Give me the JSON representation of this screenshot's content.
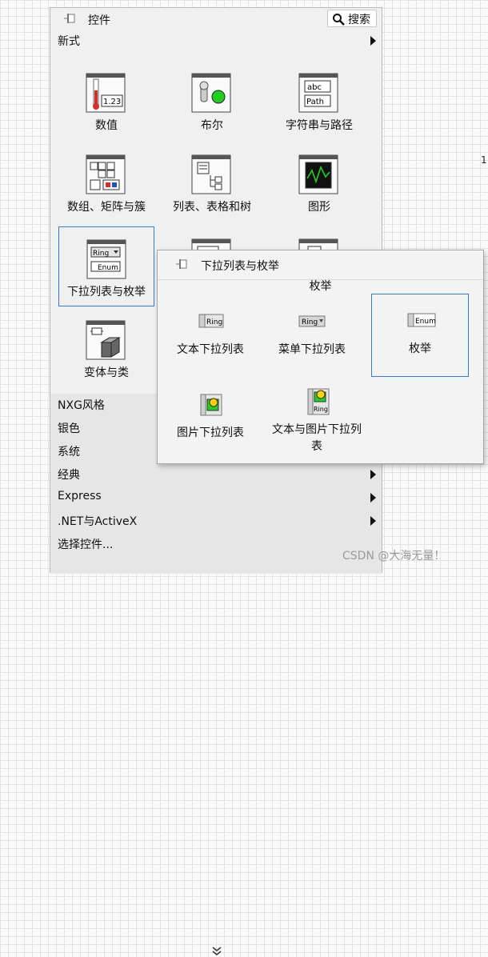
{
  "palette": {
    "title": "控件",
    "search_label": "搜索",
    "top_category": "新式",
    "items": [
      {
        "label": "数值",
        "icon": "numeric-icon"
      },
      {
        "label": "布尔",
        "icon": "boolean-icon"
      },
      {
        "label": "字符串与路径",
        "icon": "string-path-icon"
      },
      {
        "label": "数组、矩阵与簇",
        "icon": "array-matrix-cluster-icon"
      },
      {
        "label": "列表、表格和树",
        "icon": "list-table-tree-icon"
      },
      {
        "label": "图形",
        "icon": "graph-icon"
      },
      {
        "label": "下拉列表与枚举",
        "icon": "ring-enum-icon",
        "selected": true
      },
      {
        "label": "",
        "icon": "container-icon"
      },
      {
        "label": "",
        "icon": "io-icon"
      },
      {
        "label": "变体与类",
        "icon": "variant-class-icon"
      }
    ],
    "categories": [
      {
        "label": "NXG风格",
        "has_arrow": false
      },
      {
        "label": "银色",
        "has_arrow": false
      },
      {
        "label": "系统",
        "has_arrow": false
      },
      {
        "label": "经典",
        "has_arrow": true
      },
      {
        "label": "Express",
        "has_arrow": true
      },
      {
        "label": ".NET与ActiveX",
        "has_arrow": true
      },
      {
        "label": "选择控件...",
        "has_arrow": false
      }
    ]
  },
  "subpalette": {
    "title": "下拉列表与枚举",
    "section_title": "枚举",
    "items": [
      {
        "label": "文本下拉列表",
        "icon": "text-ring-icon"
      },
      {
        "label": "菜单下拉列表",
        "icon": "menu-ring-icon"
      },
      {
        "label": "枚举",
        "icon": "enum-icon",
        "selected": true
      },
      {
        "label": "图片下拉列表",
        "icon": "picture-ring-icon"
      },
      {
        "label": "文本与图片下拉列表",
        "icon": "text-picture-ring-icon"
      }
    ],
    "icon_text": {
      "ring": "Ring",
      "enum": "Enum",
      "abc": "abc",
      "path": "Path",
      "num": "1.23"
    }
  },
  "background": {
    "edge_number": "1"
  },
  "watermark": "CSDN @大海无量！",
  "colors": {
    "selection": "#2f7bd8",
    "bool_led": "#1fd11f",
    "panel": "#f0f0f0"
  }
}
